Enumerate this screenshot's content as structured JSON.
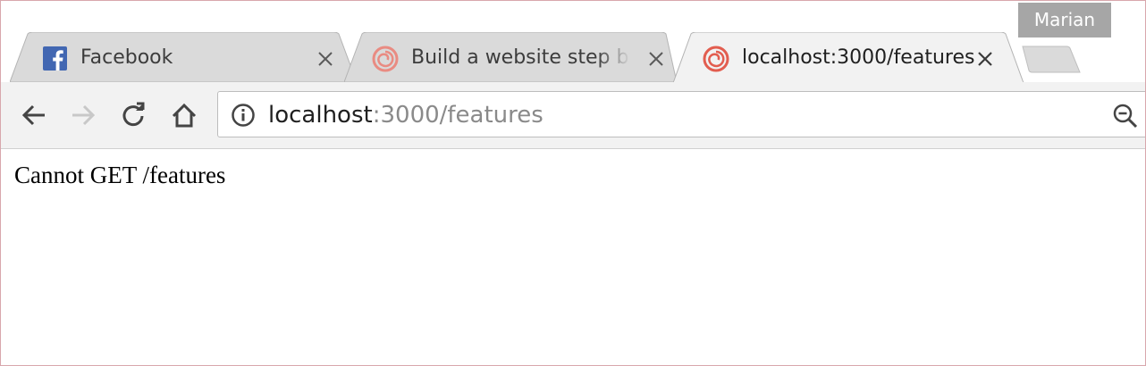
{
  "profile": {
    "name": "Marian"
  },
  "tabs": [
    {
      "title": "Facebook",
      "favicon": "facebook-icon",
      "active": false
    },
    {
      "title": "Build a website step by",
      "favicon": "swirl-icon",
      "active": false
    },
    {
      "title": "localhost:3000/features",
      "favicon": "swirl-icon",
      "active": true
    }
  ],
  "toolbar": {
    "back_icon": "arrow-left-icon",
    "forward_icon": "arrow-right-icon",
    "reload_icon": "reload-icon",
    "home_icon": "home-icon"
  },
  "omnibox": {
    "host": "localhost",
    "rest": ":3000/features",
    "info_icon": "info-icon",
    "zoom_icon": "zoom-out-icon"
  },
  "page": {
    "message": "Cannot GET /features"
  },
  "colors": {
    "tab_inactive": "#dadada",
    "tab_active": "#f2f2f2",
    "toolbar": "#f2f2f2",
    "profile_bg": "#a6a6a6",
    "swirl": "#e25d4f",
    "facebook": "#4267b2",
    "window_border": "#d8a7ad"
  }
}
